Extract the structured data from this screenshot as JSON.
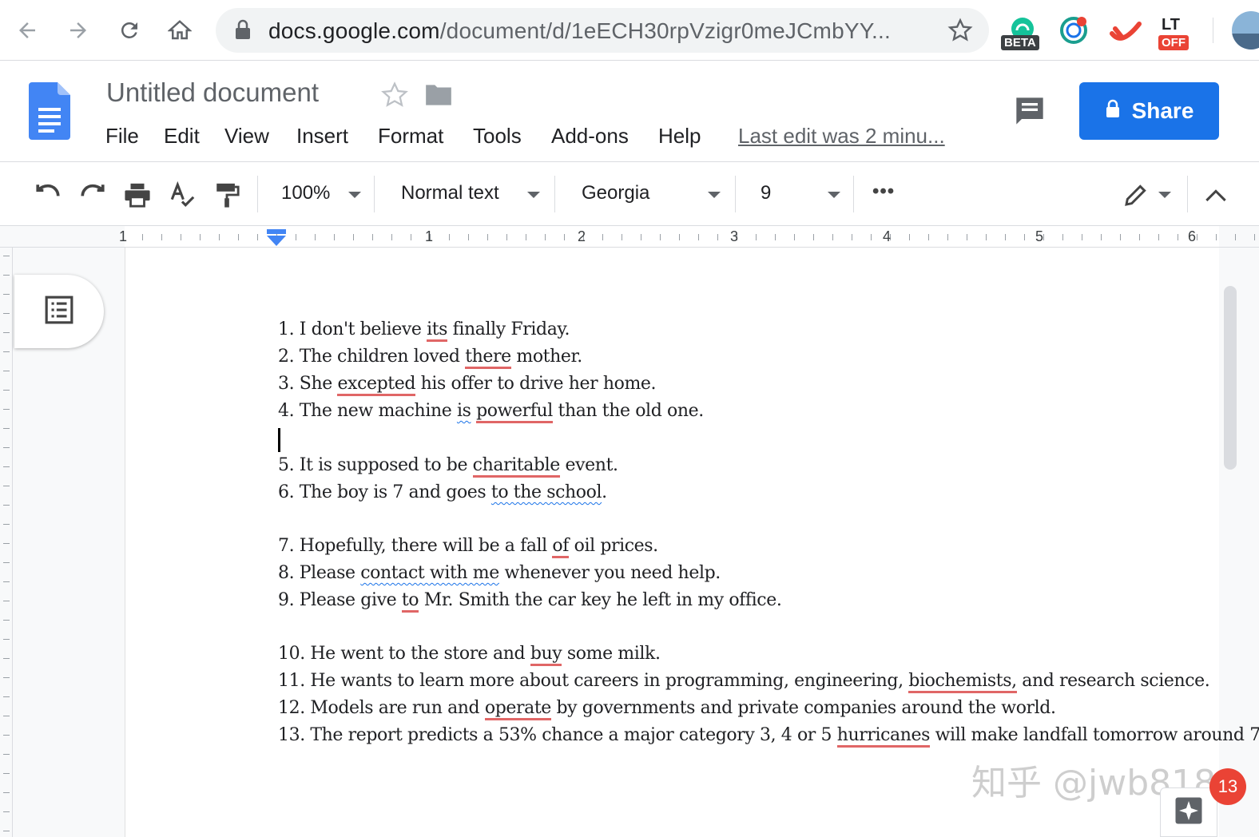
{
  "browser": {
    "url_host": "docs.google.com",
    "url_path": "/document/d/1eECH30rpVzigr0meJCmbYY...",
    "extensions": [
      {
        "name": "grammarly-extension",
        "badge": "BETA"
      },
      {
        "name": "extension-2",
        "badge": ""
      },
      {
        "name": "extension-3",
        "badge": ""
      },
      {
        "name": "languagetool-extension",
        "label": "LT",
        "badge": "OFF"
      }
    ]
  },
  "docs": {
    "title": "Untitled document",
    "menu": [
      "File",
      "Edit",
      "View",
      "Insert",
      "Format",
      "Tools",
      "Add-ons",
      "Help"
    ],
    "last_edit": "Last edit was 2 minu...",
    "share_label": "Share"
  },
  "toolbar": {
    "zoom": "100%",
    "style": "Normal text",
    "font": "Georgia",
    "font_size": "9",
    "more": "•••"
  },
  "ruler": {
    "numbers": [
      "1",
      "1",
      "2",
      "3",
      "4",
      "5",
      "6"
    ]
  },
  "document": {
    "lines": [
      [
        {
          "t": "1. I don't believe "
        },
        {
          "t": "its",
          "e": "err"
        },
        {
          "t": " finally Friday."
        }
      ],
      [
        {
          "t": "2. The children loved "
        },
        {
          "t": "there",
          "e": "err"
        },
        {
          "t": " mother."
        }
      ],
      [
        {
          "t": "3. She "
        },
        {
          "t": "excepted",
          "e": "err"
        },
        {
          "t": " his offer to drive her home."
        }
      ],
      [
        {
          "t": "4. The new machine "
        },
        {
          "t": "is",
          "e": "wavy"
        },
        {
          "t": " "
        },
        {
          "t": "powerful",
          "e": "err"
        },
        {
          "t": " than the old one."
        }
      ],
      [
        {
          "t": "5. It is supposed to be "
        },
        {
          "t": "charitable",
          "e": "err"
        },
        {
          "t": " event."
        }
      ],
      [
        {
          "t": "6. The boy is 7 and goes "
        },
        {
          "t": "to the school",
          "e": "wavy"
        },
        {
          "t": "."
        }
      ],
      [
        {
          "t": "7. Hopefully, there will be a fall "
        },
        {
          "t": "of",
          "e": "err"
        },
        {
          "t": " oil prices."
        }
      ],
      [
        {
          "t": "8. Please "
        },
        {
          "t": "contact with me",
          "e": "wavy"
        },
        {
          "t": " whenever you need help."
        }
      ],
      [
        {
          "t": "9. Please give "
        },
        {
          "t": "to",
          "e": "err"
        },
        {
          "t": " Mr. Smith the car key he left in my office."
        }
      ],
      [
        {
          "t": "10. He went to the store and "
        },
        {
          "t": "buy",
          "e": "err"
        },
        {
          "t": " some milk."
        }
      ],
      [
        {
          "t": "11. He wants to learn more about careers in programming, engineering, "
        },
        {
          "t": "biochemists,",
          "e": "err"
        },
        {
          "t": " and research science."
        }
      ],
      [
        {
          "t": "12. Models are run and "
        },
        {
          "t": "operate",
          "e": "err"
        },
        {
          "t": " by governments and private companies around the world."
        }
      ],
      [
        {
          "t": "13. The report predicts a 53% chance a major category 3, 4 or 5 "
        },
        {
          "t": "hurricanes",
          "e": "err"
        },
        {
          "t": " will make landfall tomorrow around 7"
        }
      ]
    ]
  },
  "watermark": "知乎 @jwb818",
  "notification_count": "13",
  "colors": {
    "accent": "#1a73e8",
    "error_underline": "#e06666",
    "badge": "#ea4335"
  }
}
